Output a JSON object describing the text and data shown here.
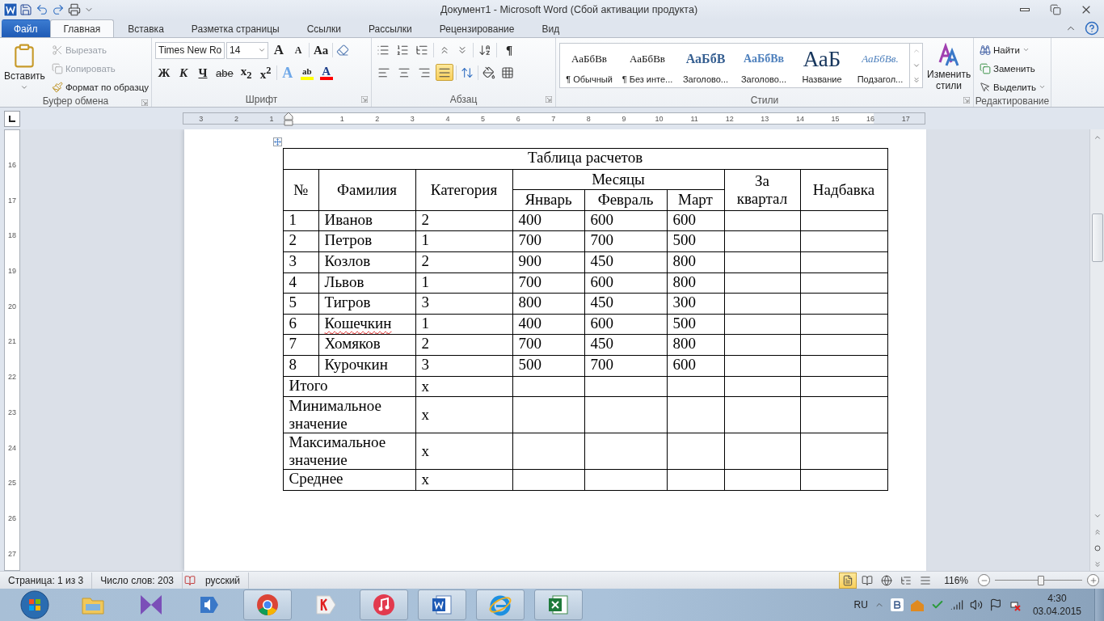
{
  "window": {
    "title": "Документ1  -  Microsoft Word (Сбой активации продукта)"
  },
  "tabs": [
    {
      "label": "Файл",
      "kind": "file",
      "selected": false
    },
    {
      "label": "Главная",
      "kind": "tab",
      "selected": true
    },
    {
      "label": "Вставка",
      "kind": "tab",
      "selected": false
    },
    {
      "label": "Разметка страницы",
      "kind": "tab",
      "selected": false
    },
    {
      "label": "Ссылки",
      "kind": "tab",
      "selected": false
    },
    {
      "label": "Рассылки",
      "kind": "tab",
      "selected": false
    },
    {
      "label": "Рецензирование",
      "kind": "tab",
      "selected": false
    },
    {
      "label": "Вид",
      "kind": "tab",
      "selected": false
    }
  ],
  "clipboard": {
    "caption": "Буфер обмена",
    "paste": "Вставить",
    "cut": {
      "label": "Вырезать",
      "disabled": true
    },
    "copy": {
      "label": "Копировать",
      "disabled": true
    },
    "format_painter": {
      "label": "Формат по образцу",
      "disabled": false
    }
  },
  "font": {
    "caption": "Шрифт",
    "name": "Times New Ro",
    "size": "14",
    "grow": "A",
    "shrink": "A",
    "case": "Aa",
    "format_buttons": [
      {
        "label": "Ж",
        "kind": "bold"
      },
      {
        "label": "К",
        "kind": "italic"
      },
      {
        "label": "Ч",
        "kind": "underline"
      },
      {
        "label": "abe",
        "kind": "strike"
      },
      {
        "label": "x$_{2}$",
        "kind": "subscript"
      },
      {
        "label": "x$^{2}$",
        "kind": "superscript"
      }
    ],
    "effects": "A",
    "highlight": {
      "label": "ab",
      "color": "#ffff00"
    },
    "font_color": {
      "label": "A",
      "color": "#ff0000"
    }
  },
  "paragraph": {
    "caption": "Абзац",
    "pilcrow": "¶",
    "alignments": [
      {
        "kind": "left",
        "selected": false
      },
      {
        "kind": "center",
        "selected": false
      },
      {
        "kind": "right",
        "selected": false
      },
      {
        "kind": "justify",
        "selected": true
      }
    ]
  },
  "styles": {
    "caption": "Стили",
    "change": "Изменить стили",
    "items": [
      {
        "preview": "АаБбВв",
        "label": "¶ Обычный",
        "kind": "normal"
      },
      {
        "preview": "АаБбВв",
        "label": "¶ Без инте...",
        "kind": "normal"
      },
      {
        "preview": "АаБбВ",
        "label": "Заголово...",
        "kind": "heading1"
      },
      {
        "preview": "АаБбВв",
        "label": "Заголово...",
        "kind": "heading2"
      },
      {
        "preview": "АаБ",
        "label": "Название",
        "kind": "title"
      },
      {
        "preview": "АаБбВв.",
        "label": "Подзагол...",
        "kind": "subtitle"
      }
    ]
  },
  "editing": {
    "caption": "Редактирование",
    "find": "Найти",
    "replace": "Заменить",
    "select": "Выделить"
  },
  "ruler": {
    "left_numbers": [
      "3",
      "2",
      "1"
    ],
    "h_numbers": [
      "1",
      "2",
      "3",
      "4",
      "5",
      "6",
      "7",
      "8",
      "9",
      "10",
      "11",
      "12",
      "13",
      "14",
      "15",
      "16",
      "17"
    ],
    "v_numbers": [
      "16",
      "17",
      "18",
      "19",
      "20",
      "21",
      "22",
      "23",
      "24",
      "25",
      "26",
      "27"
    ]
  },
  "table": {
    "title": "Таблица расчетов",
    "headers": {
      "number": "№",
      "surname": "Фамилия",
      "category": "Категория",
      "months": "Месяцы",
      "month_names": [
        "Январь",
        "Февраль",
        "Март"
      ],
      "quarter": "За квартал",
      "bonus": "Надбавка"
    },
    "rows": [
      {
        "number": "1",
        "surname": "Иванов",
        "misspelled": false,
        "category": "2",
        "values": [
          "400",
          "600",
          "600"
        ]
      },
      {
        "number": "2",
        "surname": "Петров",
        "misspelled": false,
        "category": "1",
        "values": [
          "700",
          "700",
          "500"
        ]
      },
      {
        "number": "3",
        "surname": "Козлов",
        "misspelled": false,
        "category": "2",
        "values": [
          "900",
          "450",
          "800"
        ]
      },
      {
        "number": "4",
        "surname": "Львов",
        "misspelled": false,
        "category": "1",
        "values": [
          "700",
          "600",
          "800"
        ]
      },
      {
        "number": "5",
        "surname": "Тигров",
        "misspelled": false,
        "category": "3",
        "values": [
          "800",
          "450",
          "300"
        ]
      },
      {
        "number": "6",
        "surname": "Кошечкин",
        "misspelled": true,
        "category": "1",
        "values": [
          "400",
          "600",
          "500"
        ]
      },
      {
        "number": "7",
        "surname": "Хомяков",
        "misspelled": false,
        "category": "2",
        "values": [
          "700",
          "450",
          "800"
        ]
      },
      {
        "number": "8",
        "surname": "Курочкин",
        "misspelled": false,
        "category": "3",
        "values": [
          "500",
          "700",
          "600"
        ]
      }
    ],
    "summary_rows": [
      {
        "label": "Итого",
        "category": "x"
      },
      {
        "label": "Минимальное значение",
        "category": "x"
      },
      {
        "label": "Максимальное значение",
        "category": "x"
      },
      {
        "label": "Среднее",
        "category": "x"
      }
    ]
  },
  "status_bar": {
    "page": "Страница: 1 из 3",
    "words": "Число слов: 203",
    "language": "русский",
    "zoom": "116%",
    "zoom_slider": {
      "level": 0.53
    },
    "views": [
      {
        "kind": "print",
        "selected": true
      },
      {
        "kind": "reading",
        "selected": false
      },
      {
        "kind": "web",
        "selected": false
      },
      {
        "kind": "outline",
        "selected": false
      },
      {
        "kind": "draft",
        "selected": false
      }
    ]
  },
  "taskbar": {
    "apps": [
      {
        "kind": "explorer",
        "running": false
      },
      {
        "kind": "media",
        "running": false
      },
      {
        "kind": "audio",
        "running": false
      },
      {
        "kind": "chrome",
        "running": true
      },
      {
        "kind": "yandex",
        "running": false
      },
      {
        "kind": "itunes",
        "running": true
      },
      {
        "kind": "word",
        "running": true
      },
      {
        "kind": "ie",
        "running": true
      },
      {
        "kind": "excel",
        "running": true
      }
    ],
    "tray": {
      "language": "RU",
      "time": "4:30",
      "date": "03.04.2015"
    }
  }
}
